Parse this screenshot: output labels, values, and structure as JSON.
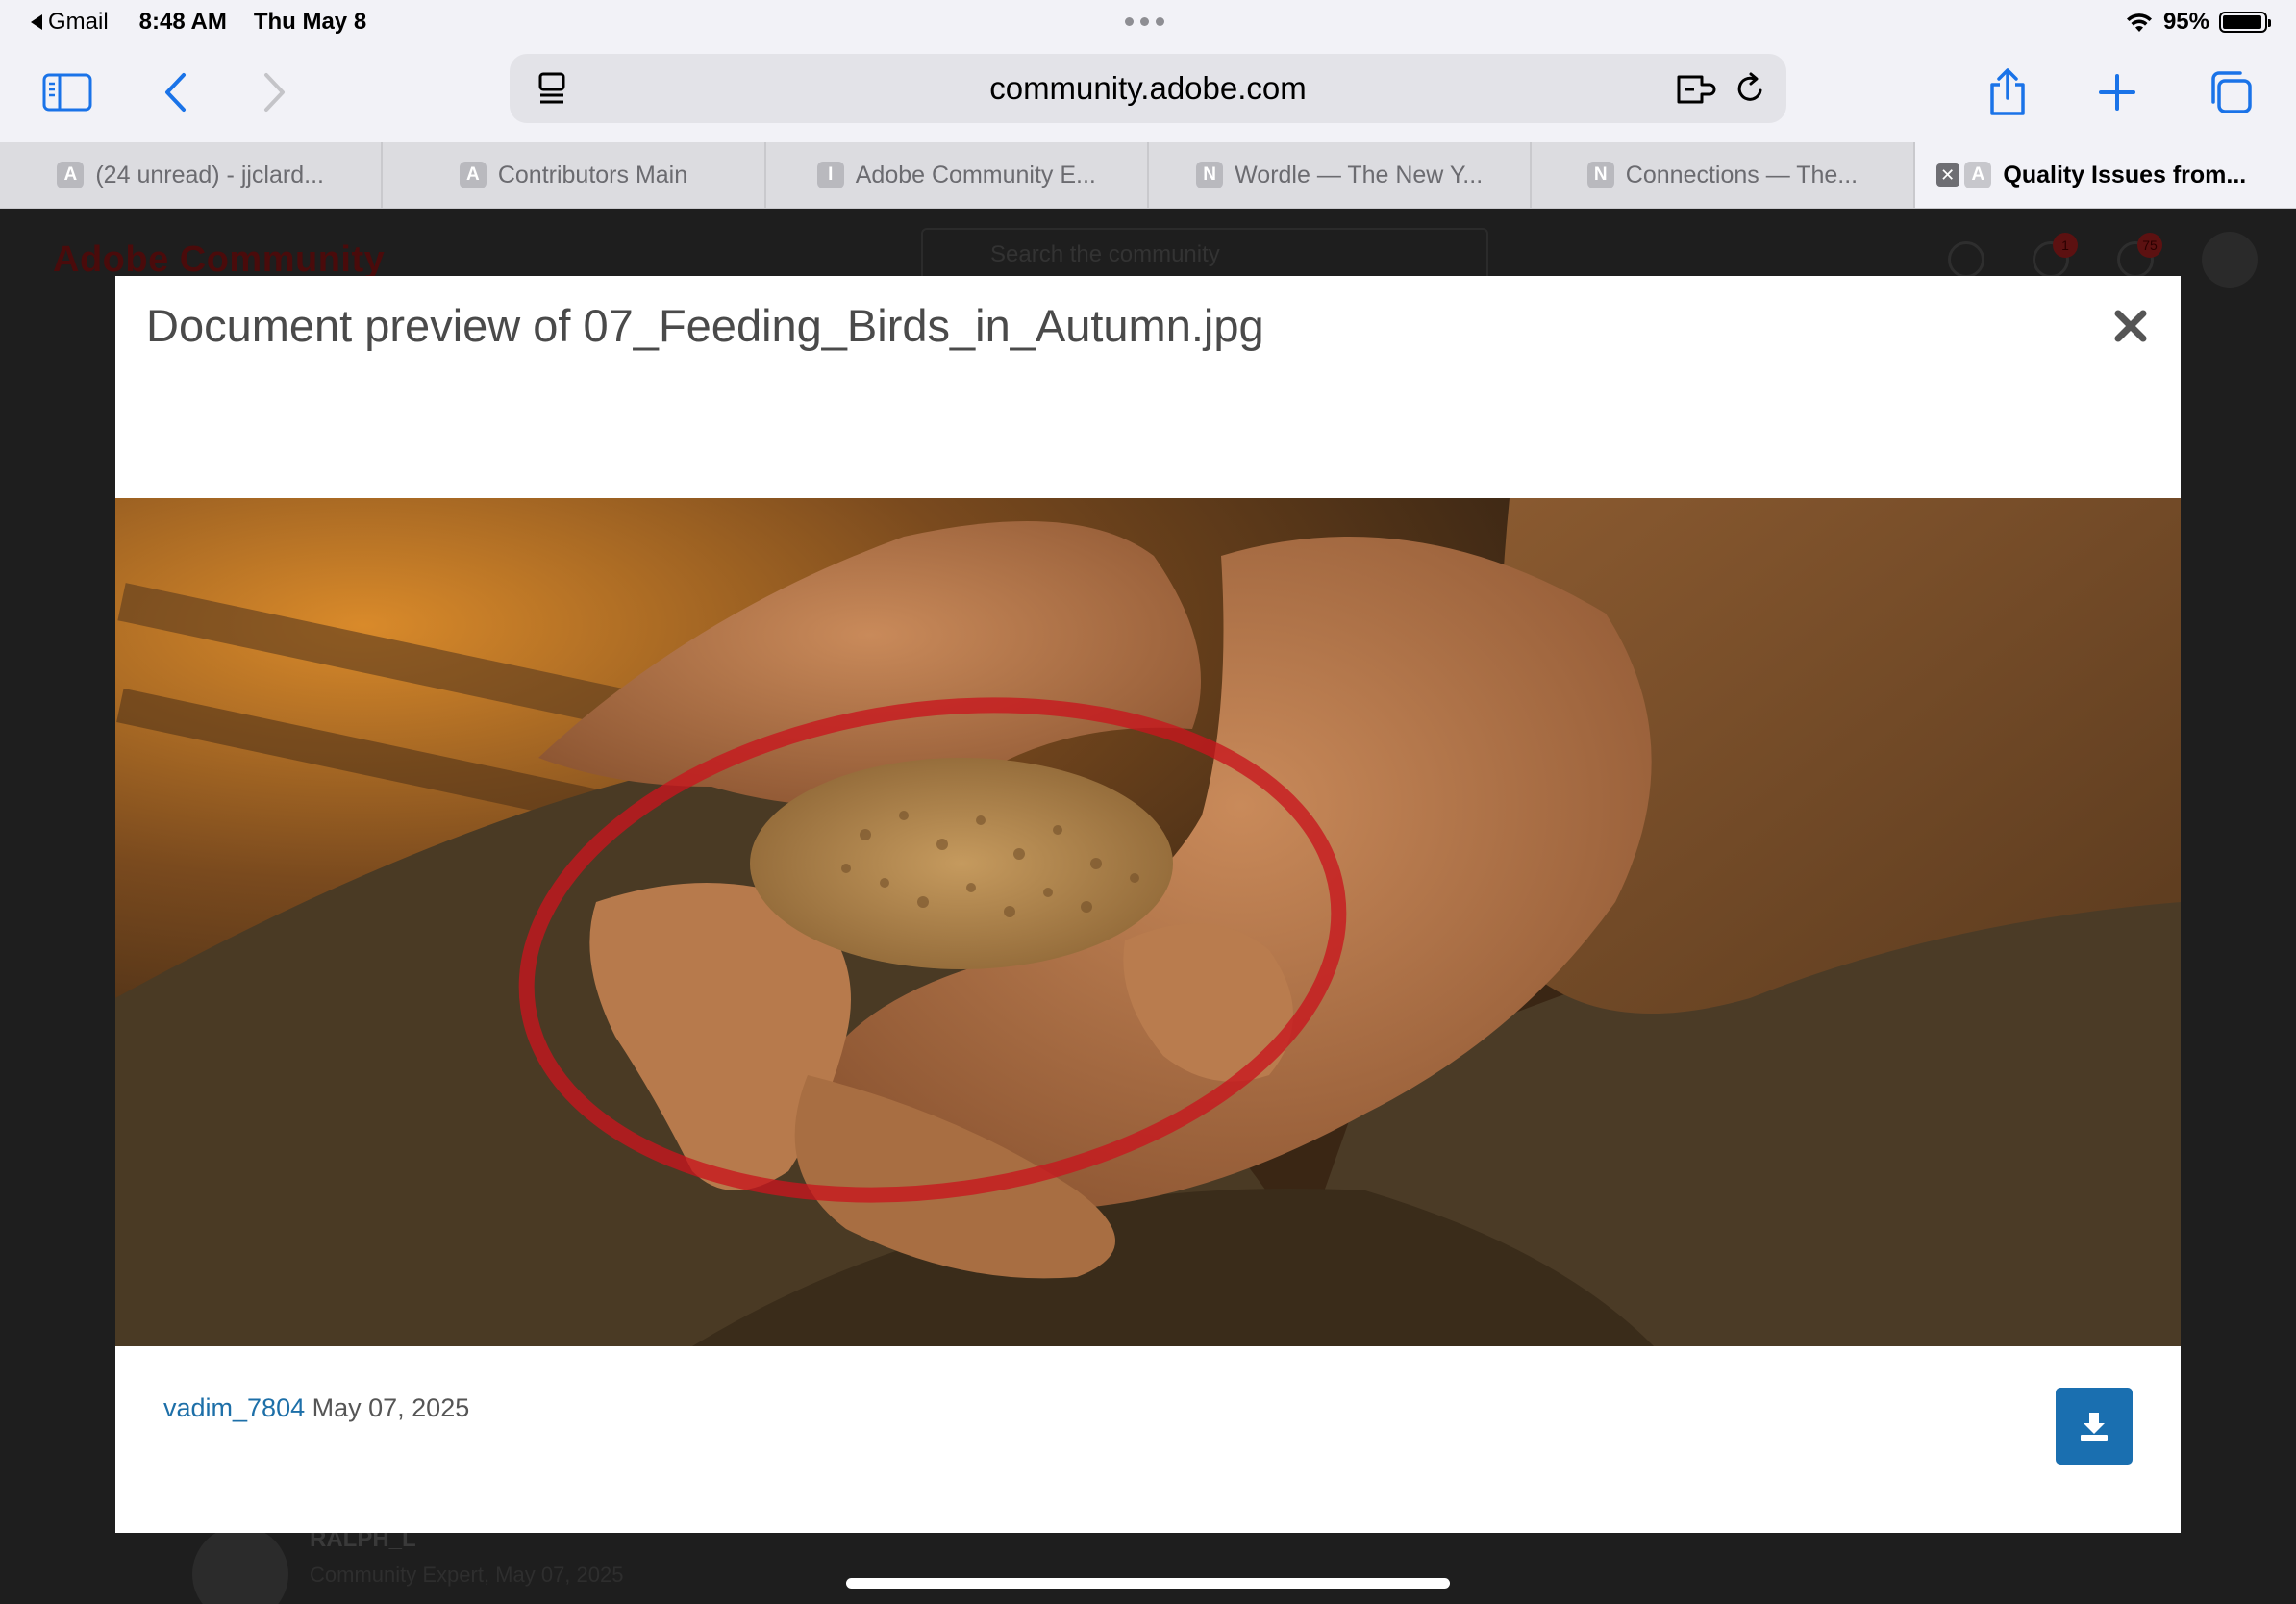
{
  "status_bar": {
    "back_app": "Gmail",
    "time": "8:48 AM",
    "date": "Thu May 8",
    "battery": "95%",
    "battery_level": 0.95
  },
  "safari": {
    "url": "community.adobe.com",
    "tabs": [
      {
        "favicon": "A",
        "label": "(24 unread) - jjclard...",
        "active": false
      },
      {
        "favicon": "A",
        "label": "Contributors Main",
        "active": false
      },
      {
        "favicon": "I",
        "label": "Adobe Community E...",
        "active": false
      },
      {
        "favicon": "N",
        "label": "Wordle — The New Y...",
        "active": false
      },
      {
        "favicon": "N",
        "label": "Connections — The...",
        "active": false
      },
      {
        "favicon": "A",
        "label": "Quality Issues from...",
        "active": true
      }
    ]
  },
  "page": {
    "logo": "Adobe Community",
    "search_placeholder": "Search the community",
    "mail_badge": "1",
    "notification_badge": "75",
    "comment_author": "RALPH_L",
    "comment_meta": "Community Expert, May 07, 2025"
  },
  "modal": {
    "title": "Document preview of 07_Feeding_Birds_in_Autumn.jpg",
    "uploader": "vadim_7804",
    "upload_date": "May 07, 2025"
  },
  "colors": {
    "link": "#1d6fa8",
    "download_button": "#1a6fb0",
    "annotation_circle": "#c8161e"
  }
}
